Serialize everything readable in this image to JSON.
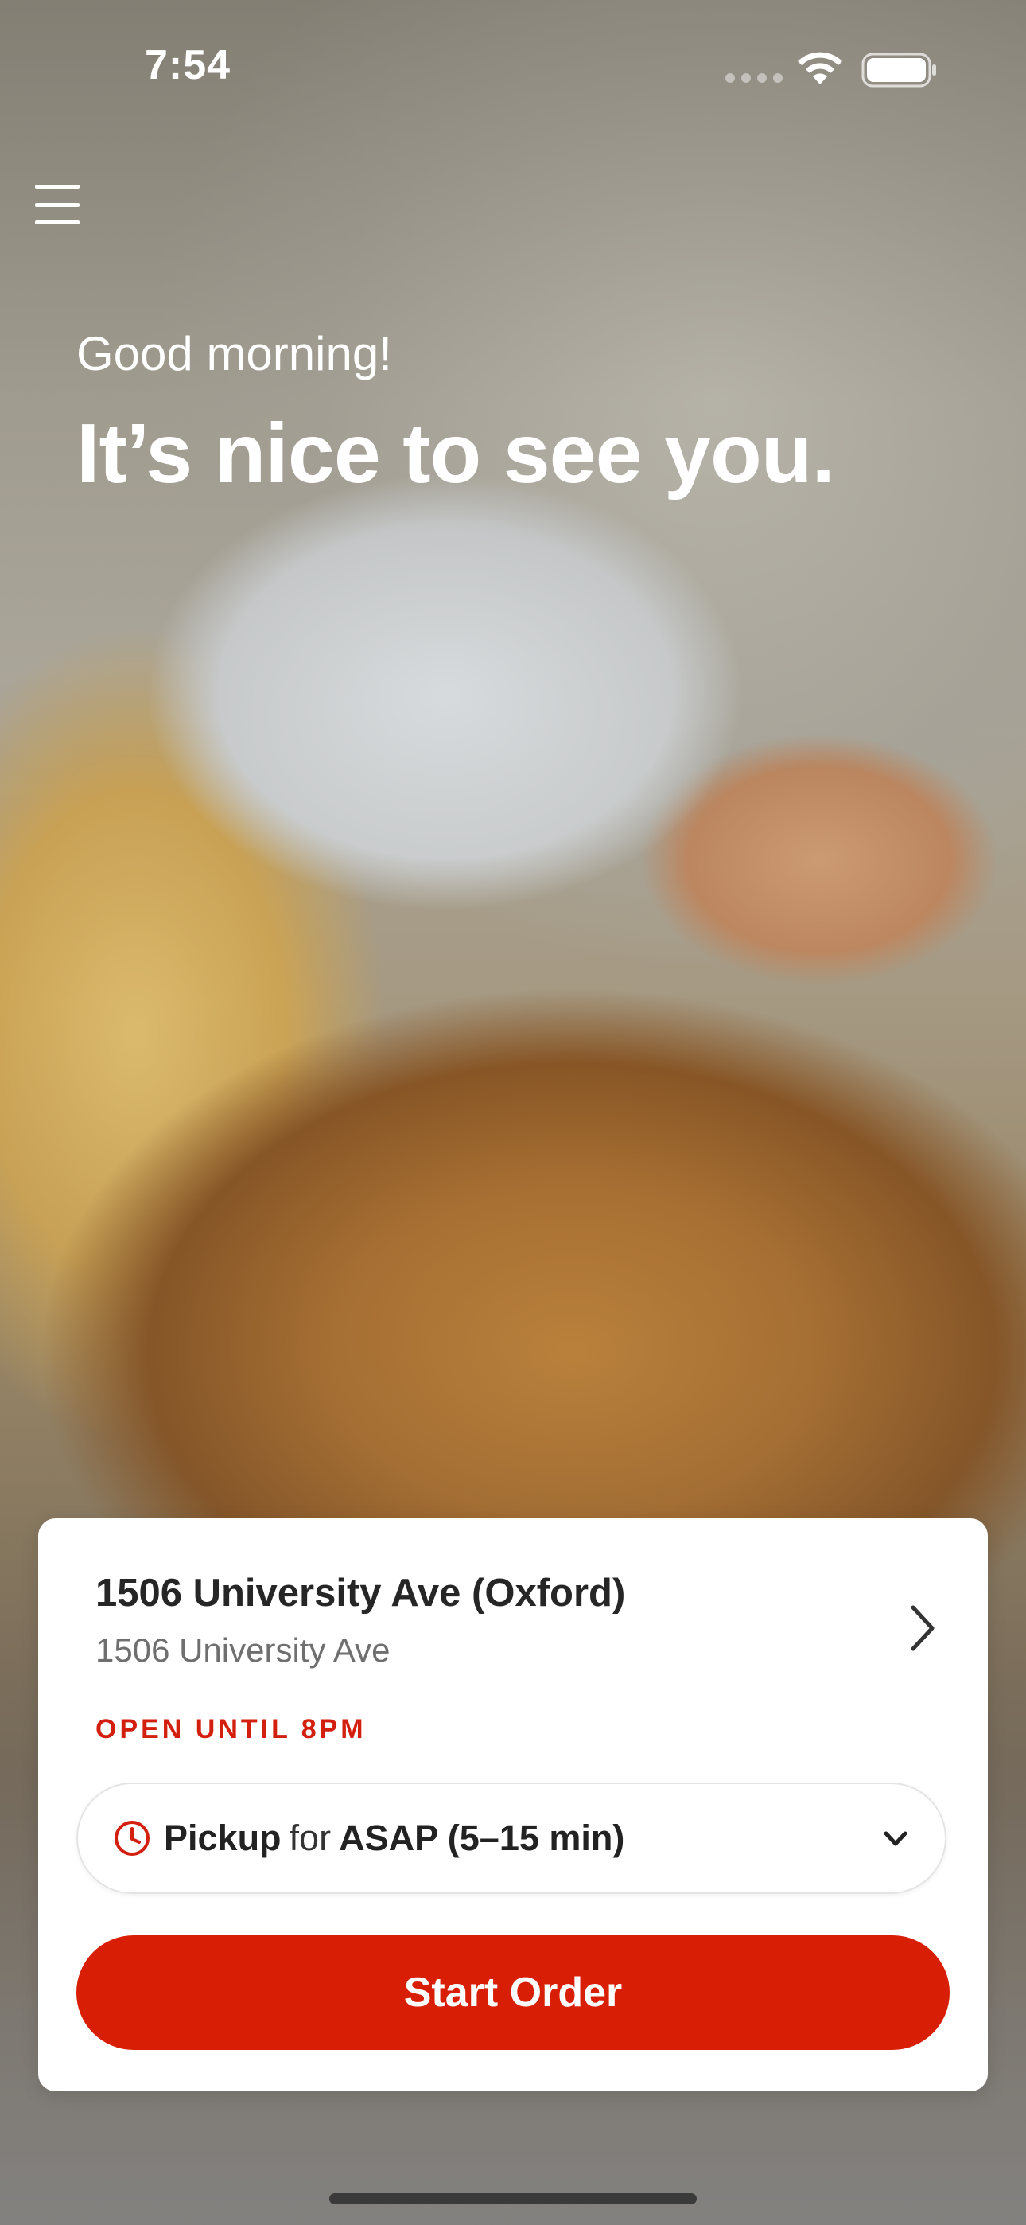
{
  "status_bar": {
    "time": "7:54"
  },
  "greeting": {
    "line1": "Good morning!",
    "line2": "It’s nice to see you."
  },
  "store": {
    "name": "1506 University Ave (Oxford)",
    "address": "1506 University Ave",
    "hours_status": "OPEN UNTIL 8PM"
  },
  "order_mode": {
    "mode": "Pickup",
    "connector": "for",
    "time": "ASAP (5–15 min)"
  },
  "actions": {
    "start_order_label": "Start Order"
  },
  "colors": {
    "accent": "#D81E05",
    "status_red": "#D31F0E",
    "card_bg": "#FFFFFF"
  },
  "icons": {
    "menu": "hamburger-menu-icon",
    "store_nav": "chevron-right-icon",
    "clock": "clock-icon",
    "dropdown": "chevron-down-icon",
    "wifi": "wifi-icon",
    "battery": "battery-icon"
  }
}
